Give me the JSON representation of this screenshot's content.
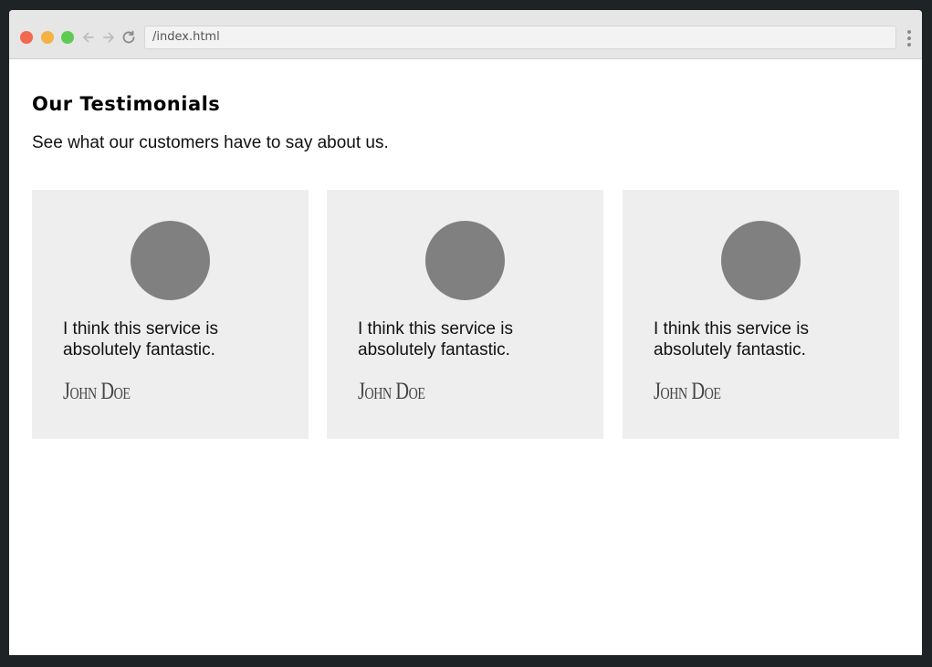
{
  "browser": {
    "url": "/index.html",
    "buttons": {
      "close_color": "#f2694f",
      "minimize_color": "#f4b243",
      "maximize_color": "#5fcb55"
    },
    "icons": [
      "back-arrow-icon",
      "forward-arrow-icon",
      "reload-icon",
      "more-menu-icon"
    ]
  },
  "page": {
    "title": "Our Testimonials",
    "subtitle": "See what our customers have to say about us."
  },
  "testimonials": [
    {
      "quote": "I think this service is absolutely fantastic.",
      "author": "John Doe"
    },
    {
      "quote": "I think this service is absolutely fantastic.",
      "author": "John Doe"
    },
    {
      "quote": "I think this service is absolutely fantastic.",
      "author": "John Doe"
    }
  ]
}
